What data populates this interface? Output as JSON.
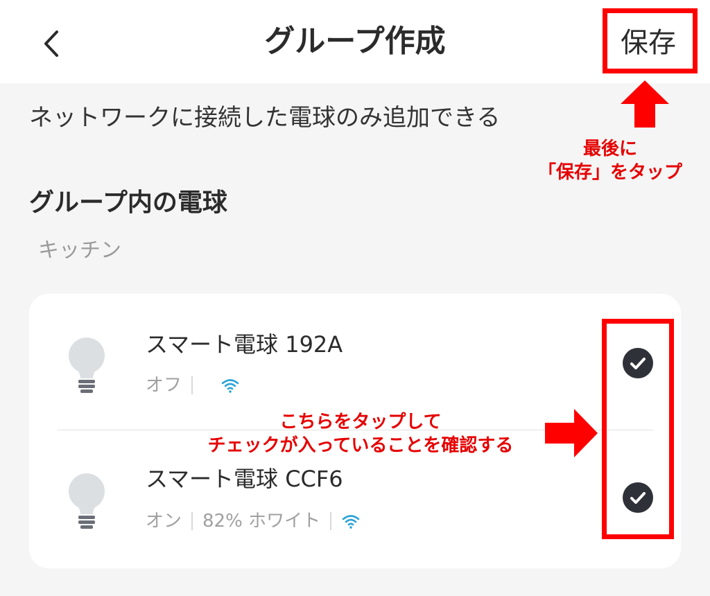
{
  "header": {
    "title": "グループ作成",
    "save_label": "保存",
    "back_icon": "chevron-left-icon"
  },
  "note": "ネットワークに接続した電球のみ追加できる",
  "section_title": "グループ内の電球",
  "group_name": "キッチン",
  "devices": [
    {
      "name": "スマート電球 192A",
      "status": "オフ",
      "brightness": "",
      "selected": true
    },
    {
      "name": "スマート電球 CCF6",
      "status": "オン",
      "brightness": "82% ホワイト",
      "selected": true
    }
  ],
  "annotations": {
    "save_note_line1": "最後に",
    "save_note_line2": "「保存」をタップ",
    "check_note_line1": "こちらをタップして",
    "check_note_line2": "チェックが入っていることを確認する"
  },
  "colors": {
    "accent_red": "#ff0000",
    "wifi_blue": "#2aa3d6",
    "check_dark": "#2f3138"
  }
}
